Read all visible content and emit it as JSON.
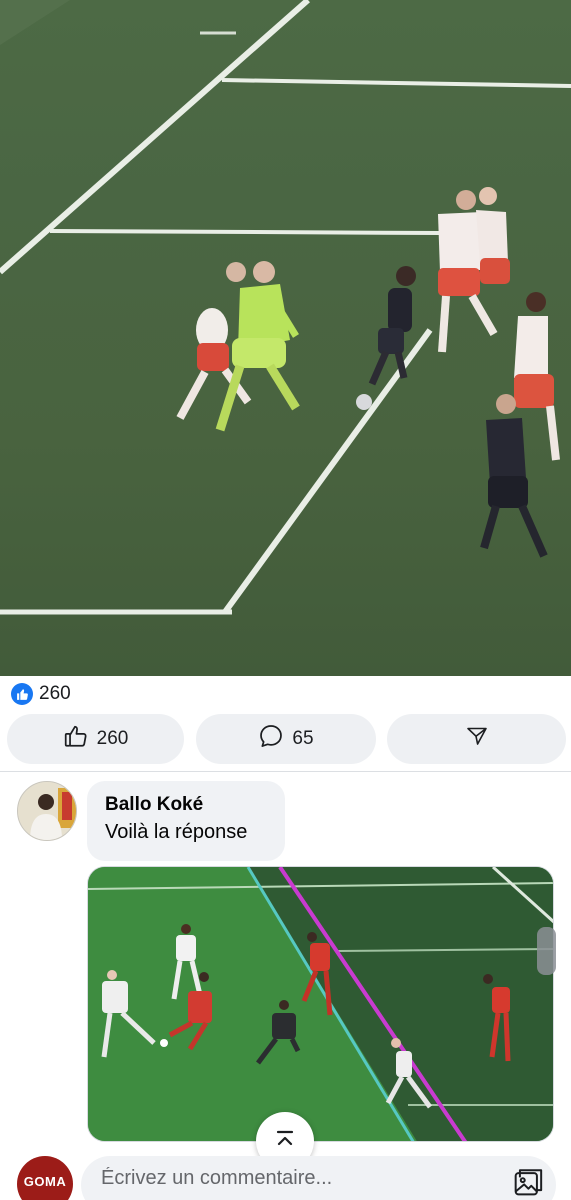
{
  "post": {
    "reaction_count": "260",
    "actions": {
      "like_count": "260",
      "comment_count": "65"
    }
  },
  "comment": {
    "author": "Ballo Koké",
    "text": "Voilà la réponse"
  },
  "composer": {
    "placeholder": "Écrivez un commentaire...",
    "avatar_text": "GOMA"
  },
  "icons": {
    "like": "thumbs-up-icon",
    "comment": "speech-bubble-icon",
    "share": "share-arrow-icon",
    "scroll_top": "chevron-up-icon",
    "add_image": "image-icon"
  },
  "colors": {
    "accent": "#1877f2",
    "pill_bg": "#eef0f3",
    "text": "#050505",
    "secondary_text": "#65676b"
  }
}
